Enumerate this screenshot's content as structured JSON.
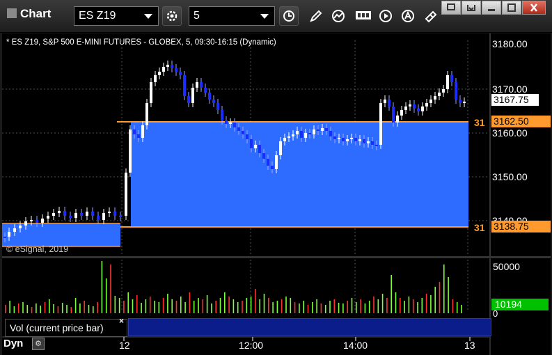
{
  "window": {
    "title": "Chart",
    "symbol": "ES Z19",
    "interval": "5"
  },
  "chart": {
    "header": "* ES Z19, S&P 500 E-MINI FUTURES - GLOBEX, 5, 09:30-16:15 (Dynamic)",
    "copyright": "© eSignal, 2019",
    "price_axis": [
      "3180.00",
      "3170.00",
      "3160.00",
      "3150.00",
      "3140.00"
    ],
    "last_price_label": "3167.75",
    "level_high_label": "3162.50",
    "level_low_label": "3138.75",
    "level_prefix": "31",
    "colors": {
      "up": "#ffffff",
      "down": "#1a2cff",
      "zone": "#2e6bff",
      "level_line": "#ff9a2e",
      "last_price_bg": "#ffffff",
      "vol_badge": "#00c000"
    }
  },
  "volume": {
    "label": "Vol (current price bar)",
    "axis_top": "50000",
    "axis_zero": "0",
    "current": "10194"
  },
  "bottom": {
    "dyn_label": "Dyn",
    "time_labels": [
      "12",
      "12:00",
      "14:00",
      "13"
    ]
  }
}
